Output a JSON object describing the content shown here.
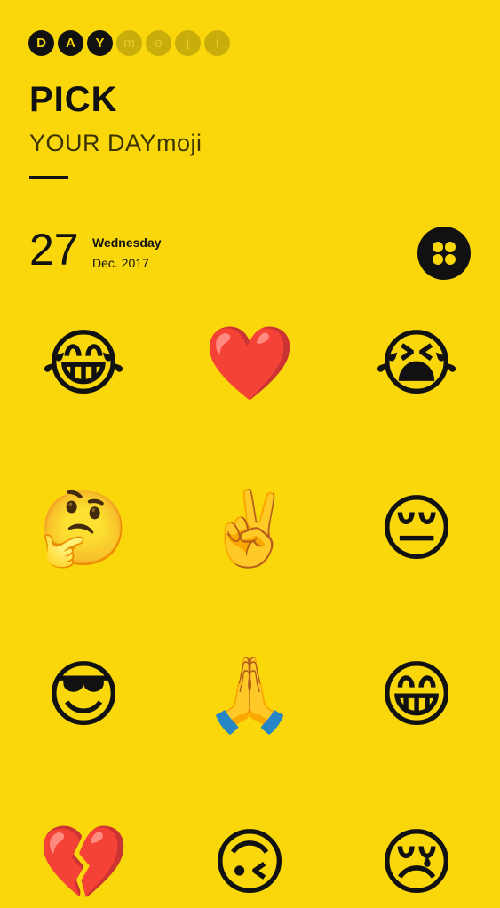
{
  "brand": {
    "letters": [
      "D",
      "A",
      "Y",
      "m",
      "o",
      "j",
      "i"
    ]
  },
  "header": {
    "title": "PICK",
    "subtitle": "YOUR DAYmoji"
  },
  "date": {
    "day": "27",
    "weekday": "Wednesday",
    "month_year": "Dec. 2017"
  },
  "emojis": [
    {
      "name": "face-with-tears-of-joy",
      "char": "😂"
    },
    {
      "name": "red-heart",
      "char": "❤️"
    },
    {
      "name": "loudly-crying-face",
      "char": "😭"
    },
    {
      "name": "thinking-face",
      "char": "🤔"
    },
    {
      "name": "victory-hand",
      "char": "✌️"
    },
    {
      "name": "pensive-face",
      "char": "😔"
    },
    {
      "name": "smiling-face-with-sunglasses",
      "char": "😎"
    },
    {
      "name": "folded-hands",
      "char": "🙏"
    },
    {
      "name": "grinning-face",
      "char": "😁"
    },
    {
      "name": "broken-heart",
      "char": "💔"
    },
    {
      "name": "upside-down-face",
      "char": "🙃"
    },
    {
      "name": "crying-face",
      "char": "😢"
    }
  ],
  "colors": {
    "background": "#F9D70B",
    "ink": "#111111",
    "faded": "#C9AD0A"
  }
}
